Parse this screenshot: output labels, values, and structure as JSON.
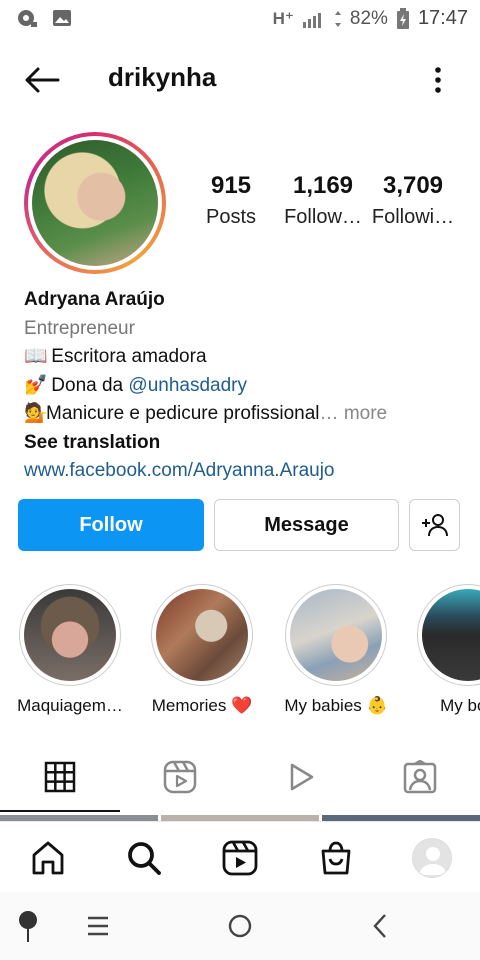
{
  "status_bar": {
    "network": "H⁺",
    "battery": "82%",
    "time": "17:47"
  },
  "header": {
    "username": "drikynha"
  },
  "stats": [
    {
      "value": "915",
      "label": "Posts"
    },
    {
      "value": "1,169",
      "label": "Follow…"
    },
    {
      "value": "3,709",
      "label": "Followi…"
    }
  ],
  "bio": {
    "name": "Adryana Araújo",
    "category": "Entrepreneur",
    "line1": "Escritora amadora",
    "line2_prefix": "Dona da ",
    "line2_mention": "@unhasdadry",
    "line3": "Manicure e pedicure profissional",
    "more": "… more",
    "see_translation": "See translation",
    "link": "www.facebook.com/Adryanna.Araujo"
  },
  "buttons": {
    "follow": "Follow",
    "message": "Message"
  },
  "highlights": [
    {
      "label": "Maquiagem…"
    },
    {
      "label": "Memories ❤️"
    },
    {
      "label": "My babies 👶"
    },
    {
      "label": "My boo"
    }
  ],
  "colors": {
    "accent": "#0d95f4",
    "link": "#1f5d91"
  }
}
